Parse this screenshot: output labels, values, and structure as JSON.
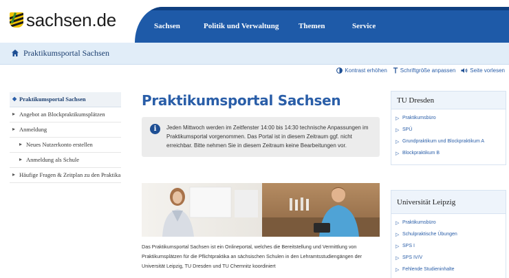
{
  "header": {
    "logo_text": "sachsen.de",
    "nav": [
      {
        "label": "Sachsen"
      },
      {
        "label": "Politik und Verwaltung"
      },
      {
        "label": "Themen"
      },
      {
        "label": "Service"
      }
    ]
  },
  "breadcrumb": {
    "label": "Praktikumsportal Sachsen"
  },
  "tools": {
    "contrast": "Kontrast erhöhen",
    "font_size": "Schriftgröße anpassen",
    "read_aloud": "Seite vorlesen"
  },
  "sidebar": {
    "items": [
      {
        "label": "Praktikumsportal Sachsen",
        "marker": "◆"
      },
      {
        "label": "Angebot an Blockpraktikumsplätzen",
        "marker": "▸"
      },
      {
        "label": "Anmeldung",
        "marker": "▸"
      },
      {
        "label": "Neues Nutzerkonto erstellen",
        "marker": "▸"
      },
      {
        "label": "Anmeldung als Schule",
        "marker": "▸"
      },
      {
        "label": "Häufige Fragen & Zeitplan zu den Praktika",
        "marker": "▸"
      }
    ]
  },
  "main": {
    "title": "Praktikumsportal Sachsen",
    "notice": "Jeden Mittwoch werden im Zeitfenster 14:00 bis 14:30 technische Anpassungen im Praktikumsportal vorgenommen. Das Portal ist in diesem Zeitraum ggf. nicht erreichbar. Bitte nehmen Sie in diesem Zeitraum keine Bearbeitungen vor.",
    "notice_icon": "i",
    "intro": "Das Praktikumsportal Sachsen ist ein Onlineportal, welches die Bereitstellung und Vermittlung von Praktikumsplätzen für die Pflichtpraktika an sächsischen Schulen in den Lehramtsstudiengängen der Universität Leipzig, TU Dresden und TU Chemnitz koordiniert"
  },
  "right": {
    "boxes": [
      {
        "title": "TU Dresden",
        "links": [
          "Praktikumsbüro",
          "SPÜ",
          "Grundpraktikum und Blockpraktikum A",
          "Blockpraktikum B"
        ]
      },
      {
        "title": "Universität Leipzig",
        "links": [
          "Praktikumsbüro",
          "Schulpraktische Übungen",
          "SPS I",
          "SPS IV/V",
          "Fehlende Studieninhalte"
        ]
      }
    ]
  },
  "colors": {
    "brand_blue": "#1e5aa8",
    "link_blue": "#2a5ea8",
    "band_blue": "#e1edf8"
  },
  "icons": {
    "home": "home-icon",
    "info": "info-icon",
    "contrast": "contrast-icon",
    "font_size": "text-size-icon",
    "read_aloud": "speaker-icon"
  }
}
